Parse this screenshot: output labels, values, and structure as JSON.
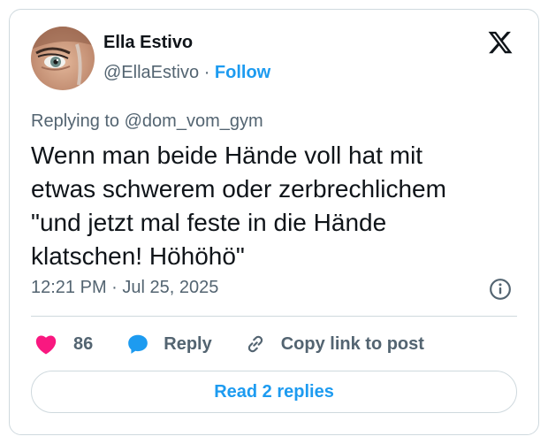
{
  "author": {
    "name": "Ella Estivo",
    "handle": "@EllaEstivo",
    "separator": "·",
    "follow_label": "Follow"
  },
  "tweet": {
    "replying_to": "Replying to @dom_vom_gym",
    "text": "Wenn man beide Hände voll hat mit\netwas schwerem oder zerbrechlichem\n\"und jetzt mal feste in die Hände\nklatschen! Höhöhö\"",
    "timestamp": "12:21 PM · Jul 25, 2025"
  },
  "actions": {
    "like_count": "86",
    "reply_label": "Reply",
    "copy_link_label": "Copy link to post"
  },
  "read_replies_label": "Read 2 replies",
  "icons": {
    "brand": "x-logo-icon",
    "like": "heart-icon",
    "reply": "speech-bubble-icon",
    "copy": "link-icon",
    "info": "info-icon"
  },
  "colors": {
    "accent": "#1d9bf0",
    "like": "#f91880",
    "secondary_text": "#536471",
    "border": "#cfd9de"
  }
}
